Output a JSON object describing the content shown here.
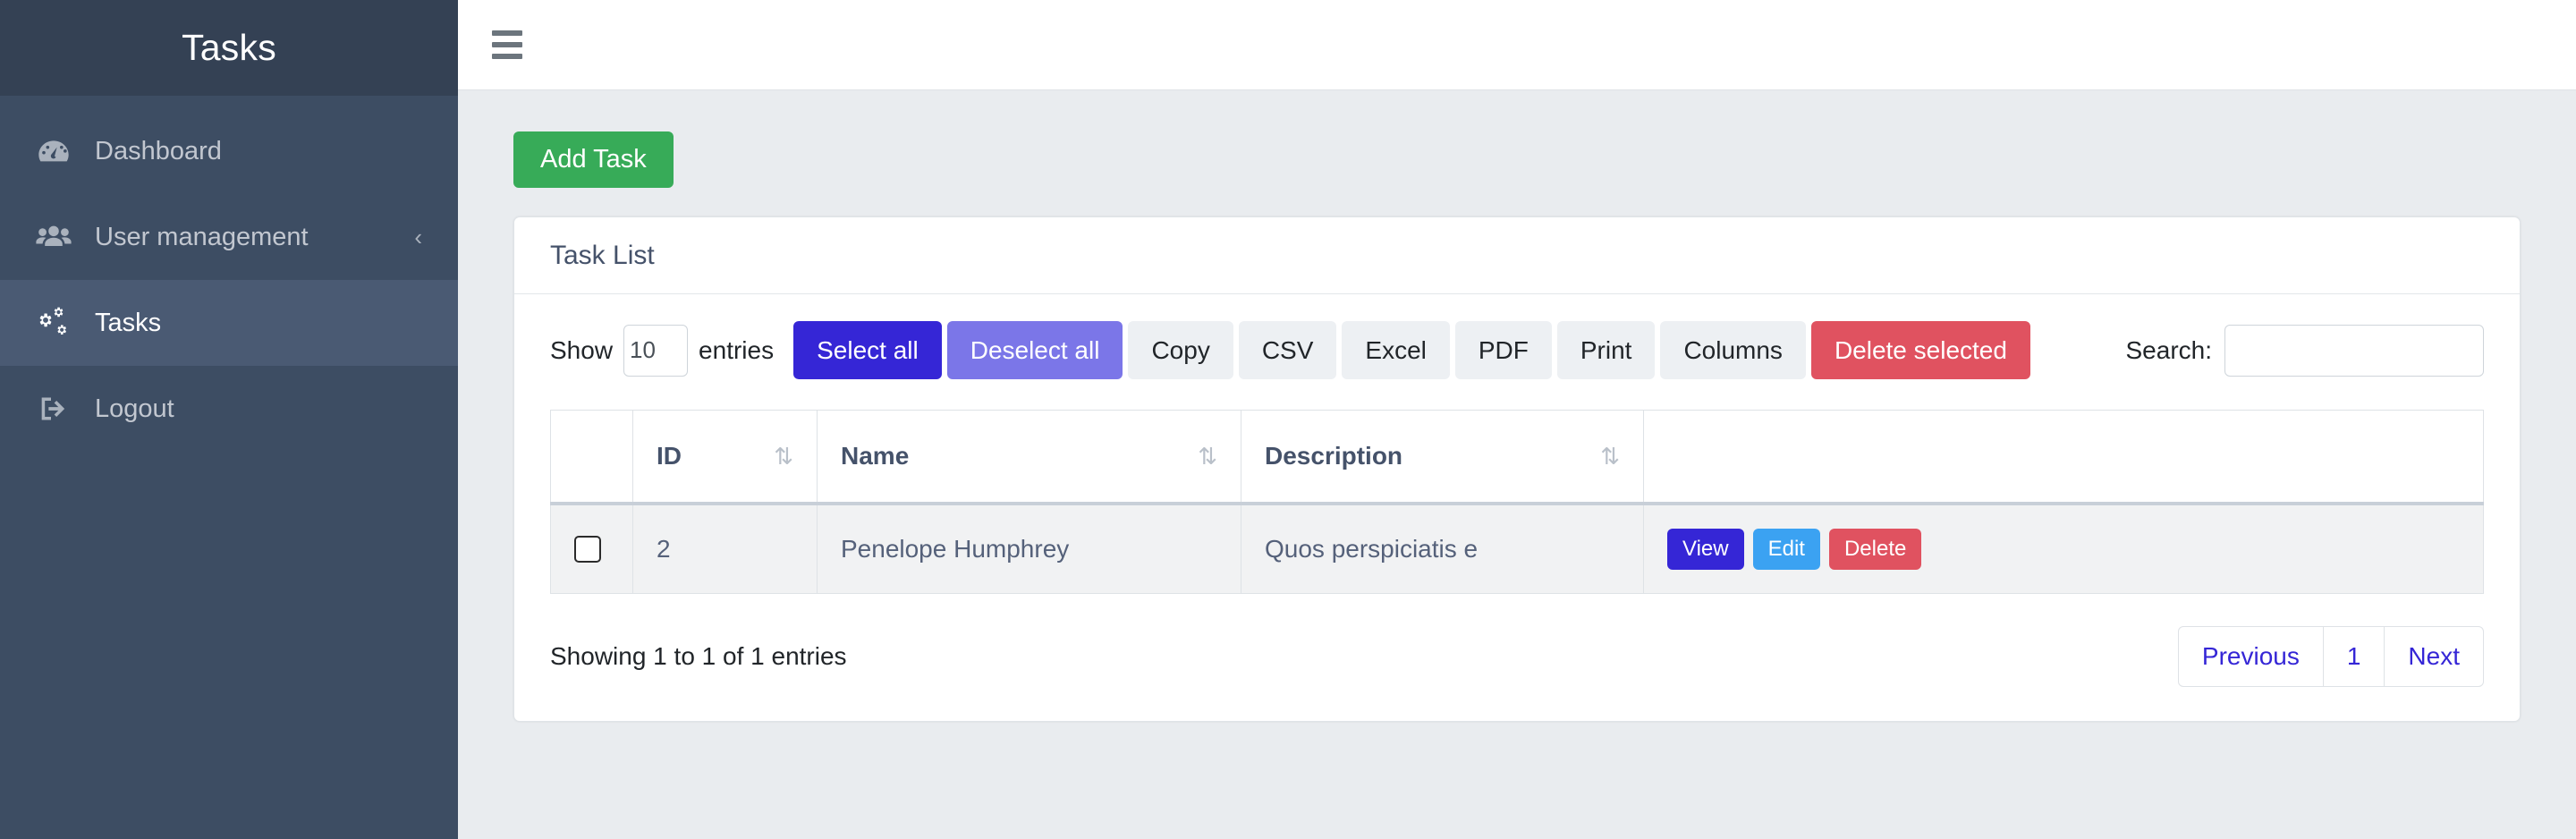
{
  "sidebar": {
    "brand": "Tasks",
    "items": [
      {
        "label": "Dashboard",
        "icon": "dashboard-icon",
        "active": false,
        "caret": ""
      },
      {
        "label": "User management",
        "icon": "users-icon",
        "active": false,
        "caret": "‹"
      },
      {
        "label": "Tasks",
        "icon": "cogs-icon",
        "active": true,
        "caret": ""
      },
      {
        "label": "Logout",
        "icon": "logout-icon",
        "active": false,
        "caret": ""
      }
    ]
  },
  "topbar": {
    "menu_icon": "hamburger-icon"
  },
  "page": {
    "add_button": "Add Task",
    "card_title": "Task List"
  },
  "controls": {
    "show_label": "Show",
    "entries_label": "entries",
    "page_length_value": "10",
    "search_label": "Search:",
    "search_value": "",
    "search_placeholder": "",
    "buttons": [
      {
        "label": "Select all",
        "style": "primary"
      },
      {
        "label": "Deselect all",
        "style": "secondary"
      },
      {
        "label": "Copy",
        "style": "light"
      },
      {
        "label": "CSV",
        "style": "light"
      },
      {
        "label": "Excel",
        "style": "light"
      },
      {
        "label": "PDF",
        "style": "light"
      },
      {
        "label": "Print",
        "style": "light"
      },
      {
        "label": "Columns",
        "style": "light"
      },
      {
        "label": "Delete selected",
        "style": "danger"
      }
    ]
  },
  "table": {
    "columns": [
      {
        "label": "",
        "sortable": false
      },
      {
        "label": "ID",
        "sortable": true
      },
      {
        "label": "Name",
        "sortable": true
      },
      {
        "label": "Description",
        "sortable": true
      },
      {
        "label": "",
        "sortable": false
      }
    ],
    "sort_glyph": "⇅",
    "rows": [
      {
        "id": "2",
        "name": "Penelope Humphrey",
        "description": "Quos perspiciatis e",
        "checked": false,
        "actions": [
          {
            "label": "View",
            "style": "view"
          },
          {
            "label": "Edit",
            "style": "edit"
          },
          {
            "label": "Delete",
            "style": "delete"
          }
        ]
      }
    ]
  },
  "footer": {
    "info": "Showing 1 to 1 of 1 entries",
    "pagination": [
      {
        "label": "Previous"
      },
      {
        "label": "1"
      },
      {
        "label": "Next"
      }
    ]
  },
  "colors": {
    "sidebar_bg": "#3d4d63",
    "sidebar_brand_bg": "#344154",
    "sidebar_active_bg": "#4a5a73",
    "add_green": "#37ab58",
    "primary_blue": "#3526d6",
    "secondary_purple": "#7b76e8",
    "danger_red": "#e05260",
    "edit_blue": "#3ba2f2",
    "content_bg": "#e9ecef"
  }
}
